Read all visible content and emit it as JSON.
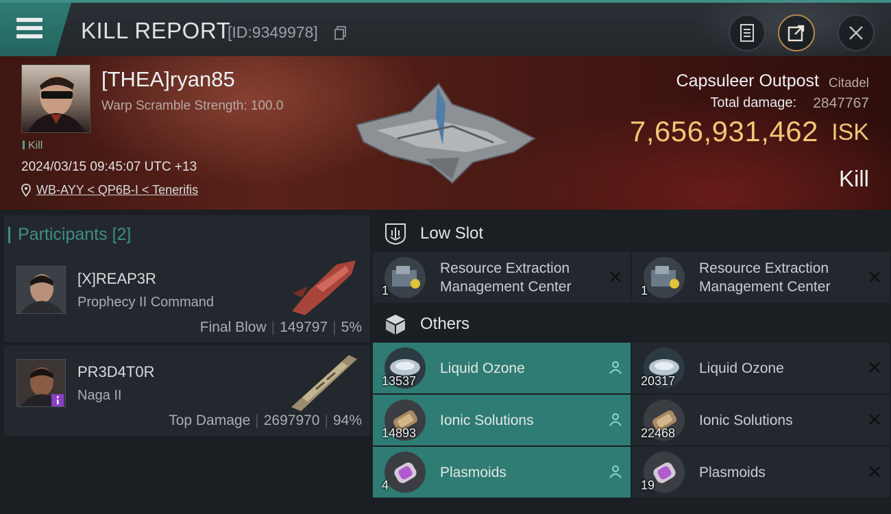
{
  "header": {
    "title": "KILL REPORT",
    "id_label": "[ID:9349978]"
  },
  "victim": {
    "name": "[THEA]ryan85",
    "subtitle": "Warp Scramble Strength: 100.0",
    "tag": "Kill",
    "timestamp": "2024/03/15 09:45:07 UTC +13",
    "location": "WB-AYY < QP6B-I < Tenerifis"
  },
  "structure": {
    "name": "Capsuleer Outpost",
    "type": "Citadel",
    "total_damage_label": "Total damage:",
    "total_damage_value": "2847767",
    "isk_value": "7,656,931,462",
    "isk_unit": "ISK",
    "result": "Kill"
  },
  "participants": {
    "title": "Participants [2]",
    "items": [
      {
        "name": "[X]REAP3R",
        "ship": "Prophecy II Command",
        "role": "Final Blow",
        "damage": "149797",
        "percent": "5%"
      },
      {
        "name": "PR3D4T0R",
        "ship": "Naga II",
        "role": "Top Damage",
        "damage": "2697970",
        "percent": "94%"
      }
    ]
  },
  "low_slot": {
    "title": "Low Slot",
    "items": [
      {
        "name": "Resource Extraction Management Center",
        "qty": "1",
        "dropped": false
      },
      {
        "name": "Resource Extraction Management Center",
        "qty": "1",
        "dropped": false
      }
    ]
  },
  "others": {
    "title": "Others",
    "items": [
      {
        "name": "Liquid Ozone",
        "qty": "13537",
        "dropped": true
      },
      {
        "name": "Liquid Ozone",
        "qty": "20317",
        "dropped": false
      },
      {
        "name": "Ionic Solutions",
        "qty": "14893",
        "dropped": true
      },
      {
        "name": "Ionic Solutions",
        "qty": "22468",
        "dropped": false
      },
      {
        "name": "Plasmoids",
        "qty": "4",
        "dropped": true
      },
      {
        "name": "Plasmoids",
        "qty": "19",
        "dropped": false
      }
    ]
  },
  "colors": {
    "accent": "#2f7c74",
    "isk": "#f3c675",
    "banner": "#5a2219"
  }
}
